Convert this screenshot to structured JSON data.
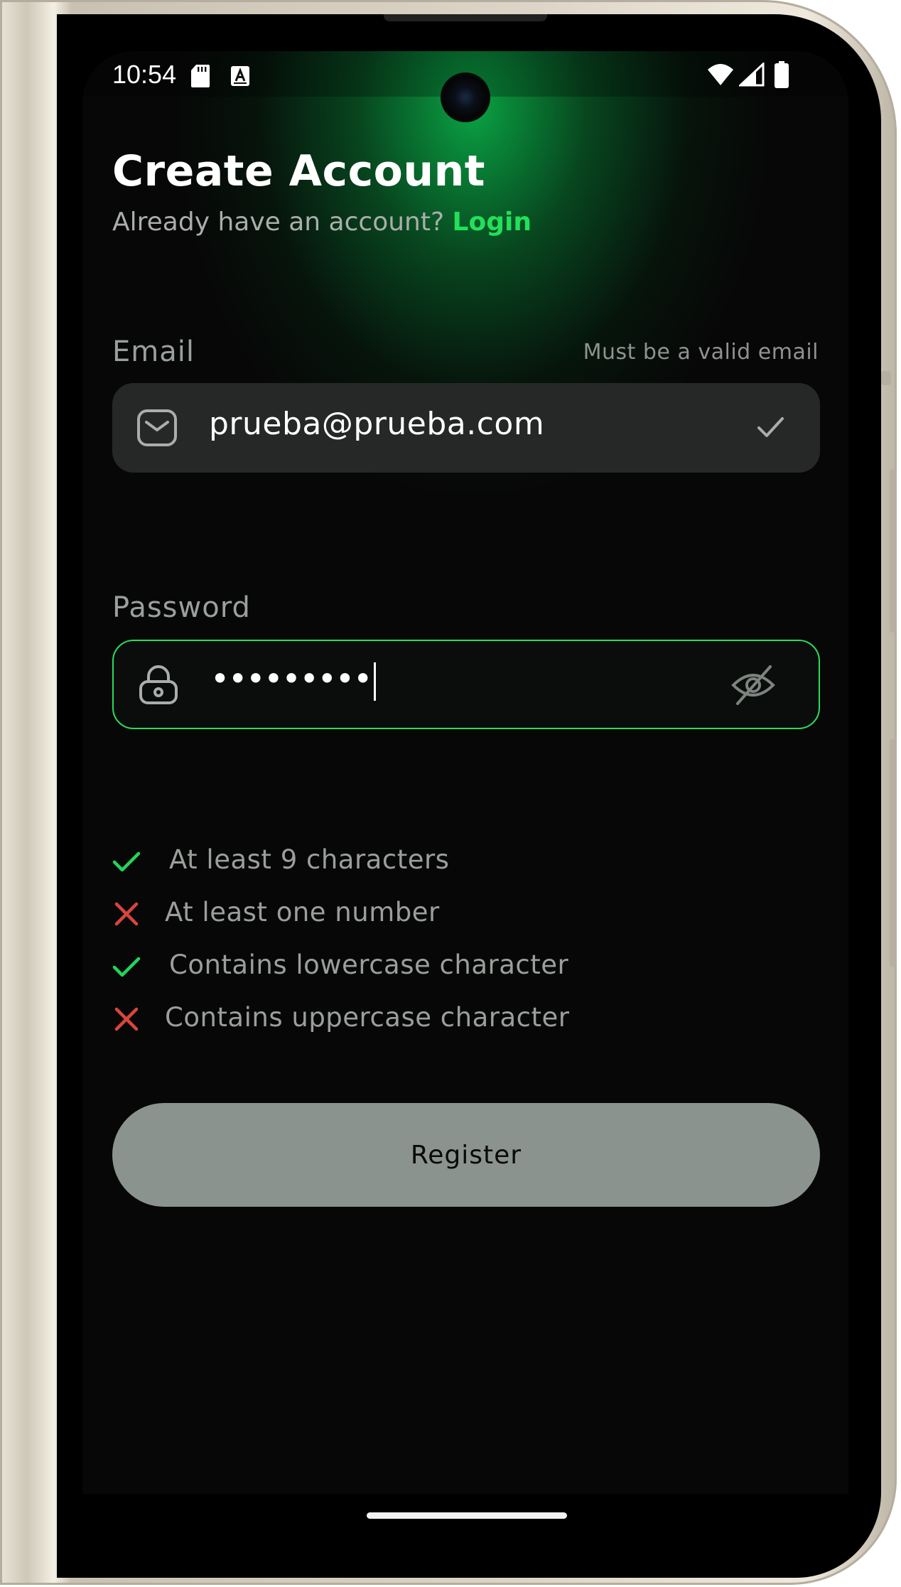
{
  "status_bar": {
    "time": "10:54",
    "icons": [
      "sd-card-icon",
      "font-a-icon",
      "wifi-icon",
      "signal-icon",
      "battery-icon"
    ]
  },
  "header": {
    "title": "Create Account",
    "subtitle_prefix": "Already have an account?",
    "login_link": "Login"
  },
  "email": {
    "label": "Email",
    "hint": "Must be a valid email",
    "value": "prueba@prueba.com",
    "icon": "mail-icon",
    "status_icon": "check-icon"
  },
  "password": {
    "label": "Password",
    "value_masked": "•••••••••",
    "icon": "lock-icon",
    "toggle_icon": "eye-off-icon"
  },
  "rules": [
    {
      "text": "At least 9 characters",
      "met": true
    },
    {
      "text": "At least one number",
      "met": false
    },
    {
      "text": "Contains lowercase character",
      "met": true
    },
    {
      "text": "Contains uppercase character",
      "met": false
    }
  ],
  "register_button": {
    "label": "Register"
  },
  "colors": {
    "accent": "#22e05a",
    "error": "#d9453d",
    "background": "#070707",
    "field_bg": "#262827",
    "button_bg": "#8a938d"
  }
}
